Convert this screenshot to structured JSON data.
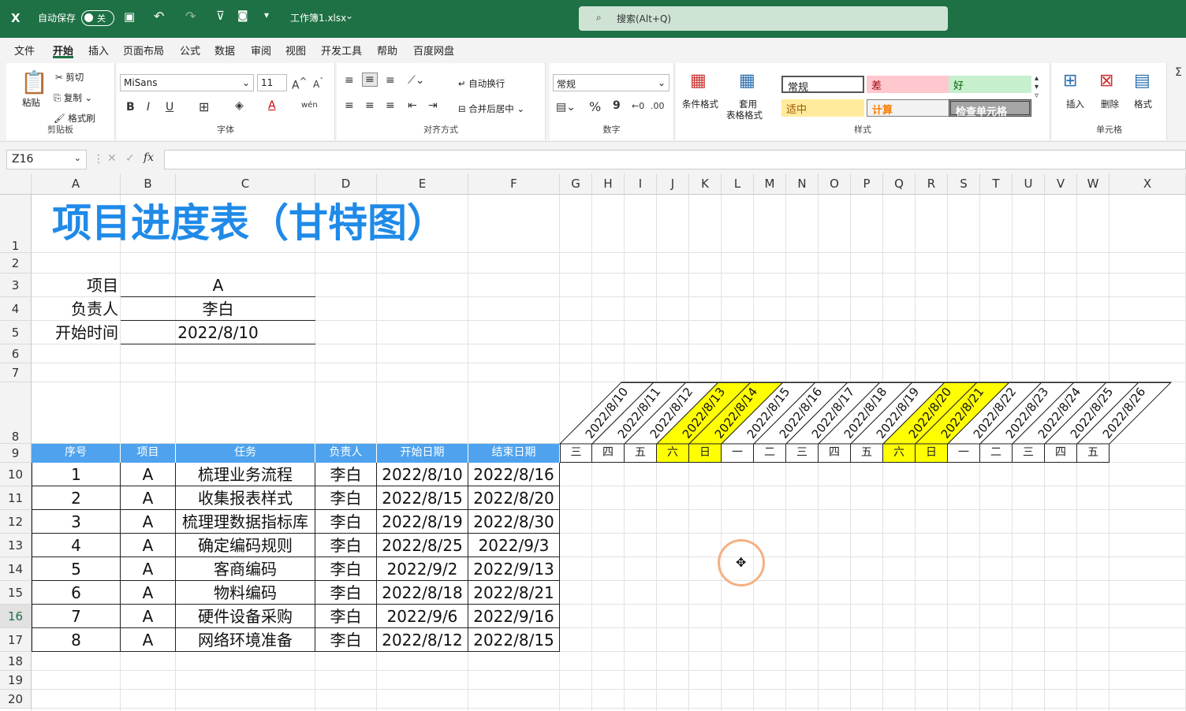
{
  "titlebar": {
    "autosave": "自动保存",
    "toggle": "关",
    "filename": "工作簿1.xlsx",
    "search": "搜索(Alt+Q)"
  },
  "menu": [
    "文件",
    "开始",
    "插入",
    "页面布局",
    "公式",
    "数据",
    "审阅",
    "视图",
    "开发工具",
    "帮助",
    "百度网盘"
  ],
  "ribbon": {
    "clipboard": {
      "paste": "粘贴",
      "cut": "剪切",
      "copy": "复制",
      "format_painter": "格式刷",
      "label": "剪贴板"
    },
    "font": {
      "name": "MiSans",
      "size": "11",
      "label": "字体"
    },
    "align": {
      "wrap": "自动换行",
      "merge": "合并后居中",
      "label": "对齐方式"
    },
    "number": {
      "format": "常规",
      "label": "数字"
    },
    "styles": {
      "cond": "条件格式",
      "table": "套用",
      "table2": "表格格式",
      "normal": "常规",
      "bad": "差",
      "good": "好",
      "neutral": "适中",
      "calc": "计算",
      "check": "检查单元格",
      "label": "样式"
    },
    "cells": {
      "insert": "插入",
      "delete": "删除",
      "format": "格式",
      "label": "单元格"
    }
  },
  "formula": {
    "namebox": "Z16",
    "fx": "fx"
  },
  "columns": [
    "A",
    "B",
    "C",
    "D",
    "E",
    "F",
    "G",
    "H",
    "I",
    "J",
    "K",
    "L",
    "M",
    "N",
    "O",
    "P",
    "Q",
    "R",
    "S",
    "T",
    "U",
    "V",
    "W",
    "X"
  ],
  "rows": [
    "1",
    "2",
    "3",
    "4",
    "5",
    "6",
    "7",
    "8",
    "9",
    "10",
    "11",
    "12",
    "13",
    "14",
    "15",
    "16",
    "17",
    "18",
    "19",
    "20"
  ],
  "sheet": {
    "title": "项目进度表（甘特图）",
    "info": [
      {
        "label": "项目",
        "value": "A"
      },
      {
        "label": "负责人",
        "value": "李白"
      },
      {
        "label": "开始时间",
        "value": "2022/8/10"
      }
    ],
    "headers": [
      "序号",
      "项目",
      "任务",
      "负责人",
      "开始日期",
      "结束日期"
    ],
    "tasks": [
      [
        "1",
        "A",
        "梳理业务流程",
        "李白",
        "2022/8/10",
        "2022/8/16"
      ],
      [
        "2",
        "A",
        "收集报表样式",
        "李白",
        "2022/8/15",
        "2022/8/20"
      ],
      [
        "3",
        "A",
        "梳理理数据指标库",
        "李白",
        "2022/8/19",
        "2022/8/30"
      ],
      [
        "4",
        "A",
        "确定编码规则",
        "李白",
        "2022/8/25",
        "2022/9/3"
      ],
      [
        "5",
        "A",
        "客商编码",
        "李白",
        "2022/9/2",
        "2022/9/13"
      ],
      [
        "6",
        "A",
        "物料编码",
        "李白",
        "2022/8/18",
        "2022/8/21"
      ],
      [
        "7",
        "A",
        "硬件设备采购",
        "李白",
        "2022/9/6",
        "2022/9/16"
      ],
      [
        "8",
        "A",
        "网络环境准备",
        "李白",
        "2022/8/12",
        "2022/8/15"
      ]
    ],
    "dates": [
      "2022/8/10",
      "2022/8/11",
      "2022/8/12",
      "2022/8/13",
      "2022/8/14",
      "2022/8/15",
      "2022/8/16",
      "2022/8/17",
      "2022/8/18",
      "2022/8/19",
      "2022/8/20",
      "2022/8/21",
      "2022/8/22",
      "2022/8/23",
      "2022/8/24",
      "2022/8/25",
      "2022/8/26"
    ],
    "weekdays": [
      "三",
      "四",
      "五",
      "六",
      "日",
      "一",
      "二",
      "三",
      "四",
      "五",
      "六",
      "日",
      "一",
      "二",
      "三",
      "四",
      "五"
    ],
    "weekend_color": "#ffff00",
    "header_color": "#4fa3ee",
    "title_color": "#1f8ae8"
  }
}
